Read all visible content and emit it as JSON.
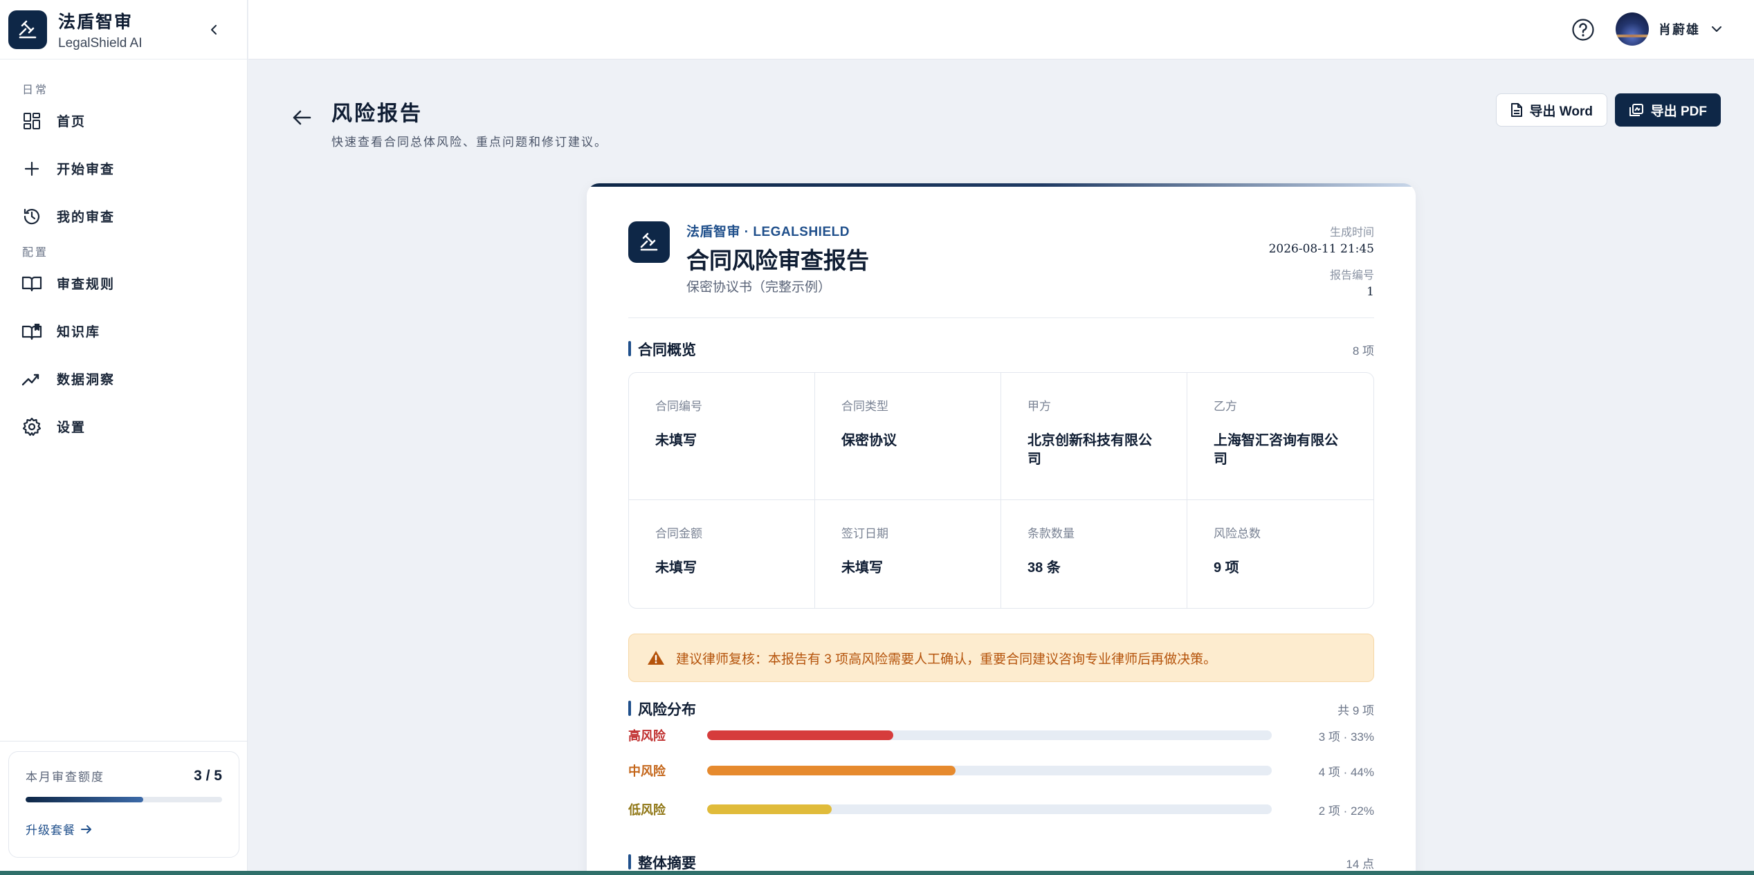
{
  "brand": {
    "name": "法盾智审",
    "subtitle": "LegalShield AI"
  },
  "sidebar": {
    "sections": [
      {
        "label": "日常",
        "items": [
          {
            "label": "首页",
            "icon": "dashboard-icon"
          },
          {
            "label": "开始审查",
            "icon": "plus-icon"
          },
          {
            "label": "我的审查",
            "icon": "history-icon"
          }
        ]
      },
      {
        "label": "配置",
        "items": [
          {
            "label": "审查规则",
            "icon": "book-icon"
          },
          {
            "label": "知识库",
            "icon": "knowledge-icon"
          },
          {
            "label": "数据洞察",
            "icon": "trend-icon"
          },
          {
            "label": "设置",
            "icon": "gear-icon"
          }
        ]
      }
    ],
    "quota": {
      "label": "本月审查额度",
      "value": "3 / 5",
      "used_fraction": 0.6,
      "upgrade": "升级套餐"
    }
  },
  "topbar": {
    "user_name": "肖蔚雄"
  },
  "page": {
    "title": "风险报告",
    "subtitle": "快速查看合同总体风险、重点问题和修订建议。",
    "export_word": "导出 Word",
    "export_pdf": "导出 PDF"
  },
  "report": {
    "brand": "法盾智审 · LEGALSHIELD",
    "title": "合同风险审查报告",
    "doc_name": "保密协议书（完整示例）",
    "generated_label": "生成时间",
    "generated_value": "2026-08-11 21:45",
    "number_label": "报告编号",
    "number_value": "1",
    "overview": {
      "title": "合同概览",
      "count": "8 项",
      "fields": [
        {
          "label": "合同编号",
          "value": "未填写"
        },
        {
          "label": "合同类型",
          "value": "保密协议"
        },
        {
          "label": "甲方",
          "value": "北京创新科技有限公司"
        },
        {
          "label": "乙方",
          "value": "上海智汇咨询有限公司"
        },
        {
          "label": "合同金额",
          "value": "未填写"
        },
        {
          "label": "签订日期",
          "value": "未填写"
        },
        {
          "label": "条款数量",
          "value": "38 条"
        },
        {
          "label": "风险总数",
          "value": "9 项"
        }
      ]
    },
    "alert": "建议律师复核：本报告有 3 项高风险需要人工确认，重要合同建议咨询专业律师后再做决策。",
    "distribution": {
      "title": "风险分布",
      "count": "共 9 项",
      "rows": [
        {
          "label": "高风险",
          "value": "3 项 · 33%",
          "fraction": 0.33,
          "color": "#d63c3c"
        },
        {
          "label": "中风险",
          "value": "4 项 · 44%",
          "fraction": 0.44,
          "color": "#e68a2e"
        },
        {
          "label": "低风险",
          "value": "2 项 · 22%",
          "fraction": 0.22,
          "color": "#e0bb3a"
        }
      ]
    },
    "summary": {
      "title": "整体摘要",
      "count": "14 点"
    }
  },
  "colors": {
    "primary": "#0e2747",
    "accent": "#1f4f8b",
    "alert_text": "#b5540c"
  }
}
